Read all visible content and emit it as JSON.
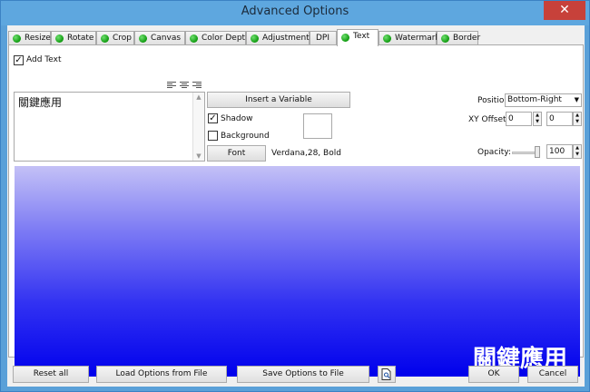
{
  "window": {
    "title": "Advanced Options",
    "close_glyph": "✕"
  },
  "tabs": [
    {
      "label": "Resize"
    },
    {
      "label": "Rotate"
    },
    {
      "label": "Crop"
    },
    {
      "label": "Canvas"
    },
    {
      "label": "Color Depth"
    },
    {
      "label": "Adjustments"
    },
    {
      "label": "DPI"
    },
    {
      "label": "Text",
      "active": true
    },
    {
      "label": "Watermark"
    },
    {
      "label": "Border"
    }
  ],
  "text_panel": {
    "add_text_label": "Add Text",
    "add_text_checked": true,
    "text_value": "關鍵應用",
    "insert_variable_label": "Insert a Variable",
    "shadow_label": "Shadow",
    "shadow_checked": true,
    "background_label": "Background",
    "background_checked": false,
    "font_button_label": "Font",
    "font_description": "Verdana,28, Bold",
    "position_label": "Position:",
    "position_value": "Bottom-Right",
    "xy_offset_label": "XY Offset:",
    "x_offset": "0",
    "y_offset": "0",
    "opacity_label": "Opacity:",
    "opacity_value": "100",
    "check_glyph": "✓"
  },
  "preview": {
    "overlay_text": "關鍵應用"
  },
  "footer": {
    "reset_label": "Reset all",
    "load_label": "Load Options from File",
    "save_label": "Save Options to File",
    "ok_label": "OK",
    "cancel_label": "Cancel"
  }
}
